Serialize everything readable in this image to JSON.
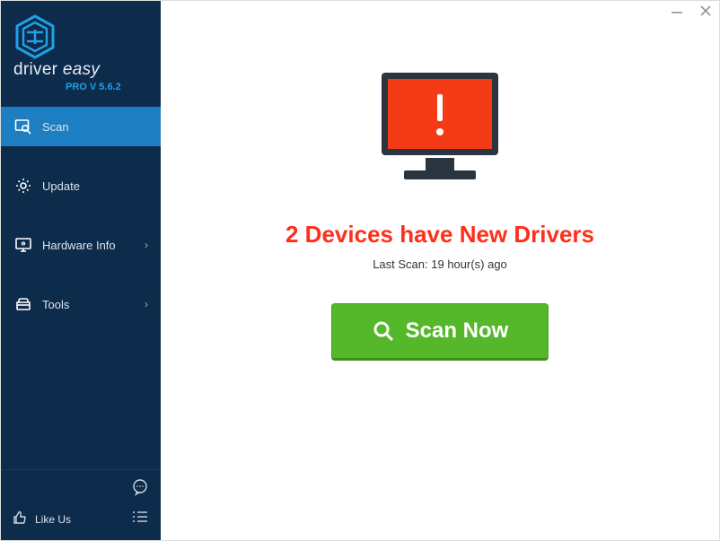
{
  "brand": {
    "name_part1": "driver ",
    "name_part2": "easy",
    "version": "PRO V 5.6.2"
  },
  "nav": {
    "scan": "Scan",
    "update": "Update",
    "hardware": "Hardware Info",
    "tools": "Tools"
  },
  "footer": {
    "like": "Like Us"
  },
  "main": {
    "headline": "2 Devices have New Drivers",
    "last_scan": "Last Scan: 19 hour(s) ago",
    "scan_button": "Scan Now"
  },
  "colors": {
    "sidebar_bg": "#0d2b4a",
    "sidebar_active": "#1d7fc2",
    "accent_blue": "#1fa1e6",
    "headline_red": "#ff2f1a",
    "button_green": "#55b72a",
    "monitor_screen": "#f43a16",
    "monitor_body": "#2b3540"
  }
}
